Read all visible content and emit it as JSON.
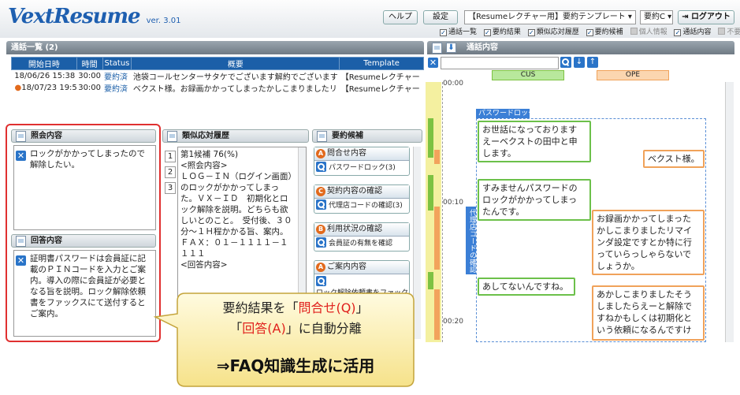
{
  "header": {
    "logo": "VextResume",
    "version": "ver. 3.01",
    "help_label": "ヘルプ",
    "settings_label": "設定",
    "template_select": "【Resumeレクチャー用】要約テンプレート",
    "summary_select": "要約C",
    "logout_label": "ログアウト",
    "checkboxes": [
      {
        "label": "通話一覧",
        "checked": true
      },
      {
        "label": "要約結果",
        "checked": true
      },
      {
        "label": "類似応対履歴",
        "checked": true
      },
      {
        "label": "要約候補",
        "checked": true
      },
      {
        "label": "個人情報",
        "checked": false
      },
      {
        "label": "通話内容",
        "checked": true
      },
      {
        "label": "不要語",
        "checked": false
      }
    ]
  },
  "call_list": {
    "title": "通話一覧 (2)",
    "columns": [
      "開始日時",
      "時間",
      "Status",
      "概要",
      "Template"
    ],
    "rows": [
      {
        "datetime": "18/06/26 15:38",
        "duration": "30:00",
        "status": "要約済",
        "summary": "池袋コールセンターサタケでございます解約でございます",
        "template": "【Resumeレクチャー",
        "active": false
      },
      {
        "datetime": "18/07/23 19:57",
        "duration": "30:00",
        "status": "要約済",
        "summary": "ベクスト様。お録画かかってしまったかしこまりましたリ",
        "template": "【Resumeレクチャー",
        "active": true
      }
    ]
  },
  "inquiry": {
    "title": "照会内容",
    "text": "ロックがかかってしまったので解除したい。"
  },
  "answer": {
    "title": "回答内容",
    "text": "証明書パスワードは会員証に記載のＰＩＮコードを入力とご案内。導入の際に会員証が必要となる旨を説明。ロック解除依頼書をファックスにて送付するとご案内。"
  },
  "similar": {
    "title": "類似応対履歴",
    "pages": [
      "1",
      "2",
      "3"
    ],
    "text": "第1候補 76(%)\n<照会内容>\nＬＯＧ－ＩＮ（ログイン画面）のロックがかかってしまった。ＶＸ－ＩＤ　初期化とロック解除を説明。どちらも欲しいとのこと。　受付後、３０分～１Ｈ程かかる旨、案内。　ＦＡＸ：０１－１１１１－１１１１\n<回答内容>"
  },
  "candidates": {
    "title": "要約候補",
    "groups": [
      {
        "badge": "A",
        "label": "問合せ内容",
        "item": "パスワードロック(3)"
      },
      {
        "badge": "C",
        "label": "契約内容の確認",
        "item": "代理店コードの確認(3)"
      },
      {
        "badge": "B",
        "label": "利用状況の確認",
        "item": "会員証の有無を確認"
      },
      {
        "badge": "A",
        "label": "ご案内内容",
        "item": "ロック解除依頼書をファック"
      }
    ]
  },
  "transcript": {
    "title": "通話内容",
    "cus_label": "CUS",
    "ope_label": "OPE",
    "ticks": [
      "00:00",
      "00:10",
      "00:20"
    ],
    "tag_password": "パスワードロック",
    "tag_agent": "代理店コードの確認",
    "utterances": [
      {
        "speaker": "cus",
        "text": "お世話になっております\nえーベクストの田中と申\nします。"
      },
      {
        "speaker": "ope",
        "text": "ベクスト様。"
      },
      {
        "speaker": "cus",
        "text": "すみませんパスワードの\nロックがかかってしまっ\nたんです。"
      },
      {
        "speaker": "ope",
        "text": "お録画かかってしまった\nかしこまりましたリマイ\nンダ設定ですとか特に行\nっていらっしゃらないで\nしょうか。"
      },
      {
        "speaker": "cus",
        "text": "あしてないんですね。"
      },
      {
        "speaker": "ope",
        "text": "あかしこまりましたそう\nしましたらえーと解除で\nすねかもしくは初期化と\nいう依頼になるんですけ"
      }
    ]
  },
  "callout": {
    "line1_pre": "要約結果を「",
    "line1_red": "問合せ(Q)",
    "line1_post": "」",
    "line2_pre": "「",
    "line2_red": "回答(A)",
    "line2_post": "」に自動分離",
    "line3": "⇒FAQ知識生成に活用"
  },
  "colors": {
    "accent": "#1b5fa8",
    "cus": "#6cc04a",
    "ope": "#f0a25a",
    "callout_red": "#e0201c",
    "highlight": "#e03030"
  }
}
